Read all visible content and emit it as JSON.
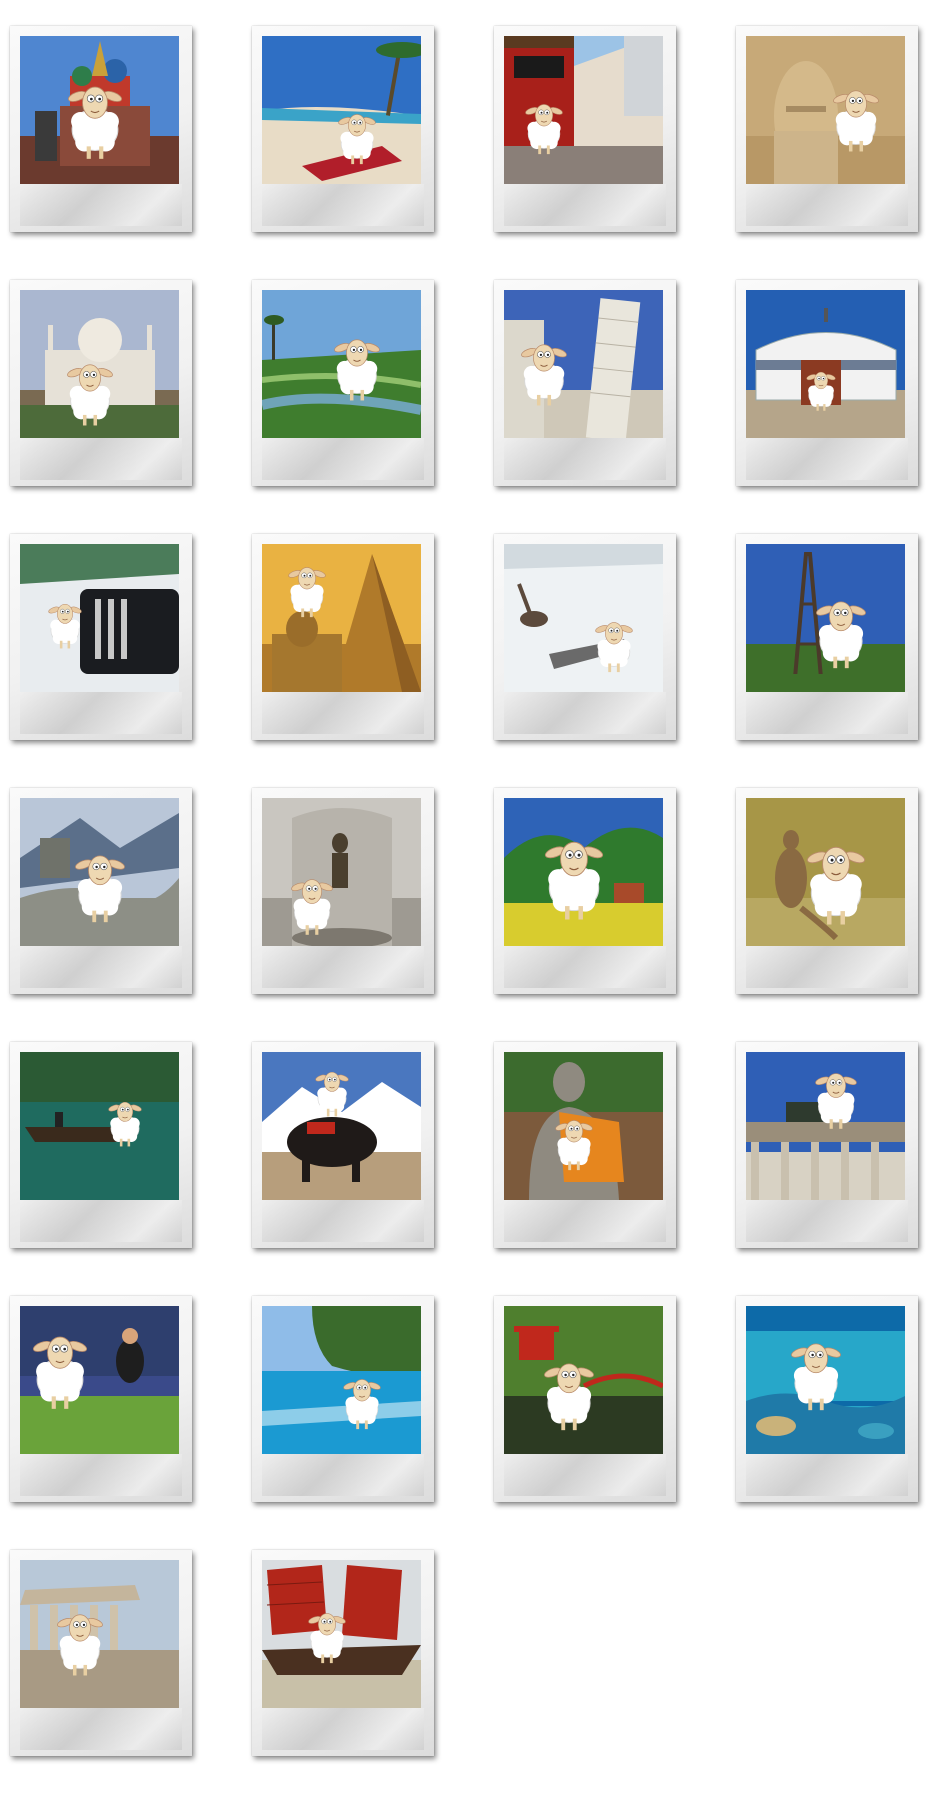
{
  "gallery": {
    "photos": [
      {
        "scene": "moscow-cathedral",
        "sky": "#4f86d0",
        "ground": "#6b3a2e",
        "accent": "#c0392b"
      },
      {
        "scene": "tropical-beach",
        "sky": "#2f6fc4",
        "ground": "#e8dcc6",
        "accent": "#b11e2a"
      },
      {
        "scene": "chinese-street",
        "sky": "#9cc3e6",
        "ground": "#8a7f78",
        "accent": "#a8201a"
      },
      {
        "scene": "stone-head-statue",
        "sky": "#c7a978",
        "ground": "#b89866",
        "accent": "#d4b98a"
      },
      {
        "scene": "taj-mahal",
        "sky": "#aab7d0",
        "ground": "#7a6a52",
        "accent": "#e6e1d7"
      },
      {
        "scene": "rice-terraces",
        "sky": "#6fa5d8",
        "ground": "#3f7d2e",
        "accent": "#8fbf6a"
      },
      {
        "scene": "leaning-tower-pisa",
        "sky": "#3d64b8",
        "ground": "#cfc8b8",
        "accent": "#e9e6dc"
      },
      {
        "scene": "yurt",
        "sky": "#245fb3",
        "ground": "#b5a58a",
        "accent": "#8b3a22"
      },
      {
        "scene": "limousine",
        "sky": "#e6ecef",
        "ground": "#1a1c20",
        "accent": "#2c7a3c"
      },
      {
        "scene": "sphinx-pyramid",
        "sky": "#e9b242",
        "ground": "#b07a2a",
        "accent": "#8e5e22"
      },
      {
        "scene": "reindeer-sled",
        "sky": "#c9d2d8",
        "ground": "#eef2f4",
        "accent": "#5c4a3c"
      },
      {
        "scene": "eiffel-tower",
        "sky": "#2f5fb6",
        "ground": "#3e6f2a",
        "accent": "#4b3a2a"
      },
      {
        "scene": "great-wall",
        "sky": "#b9c6d8",
        "ground": "#8d8f86",
        "accent": "#5b6f8a"
      },
      {
        "scene": "manneken-pis",
        "sky": "#c9c6c0",
        "ground": "#9e9a92",
        "accent": "#4a3f2e"
      },
      {
        "scene": "alpine-meadow",
        "sky": "#2e63b7",
        "ground": "#d8cc2e",
        "accent": "#2f7a2d"
      },
      {
        "scene": "kangaroo-outback",
        "sky": "#a79647",
        "ground": "#b8a862",
        "accent": "#8a6a42"
      },
      {
        "scene": "ha-long-boat",
        "sky": "#2b5a34",
        "ground": "#1f6b5f",
        "accent": "#3a2a1c"
      },
      {
        "scene": "yak-mountains",
        "sky": "#4a77bf",
        "ground": "#b79e7c",
        "accent": "#1f1a18"
      },
      {
        "scene": "buddha-statue",
        "sky": "#3c6b2e",
        "ground": "#7c5a3c",
        "accent": "#e6861e"
      },
      {
        "scene": "brandenburg-gate",
        "sky": "#2f5fb6",
        "ground": "#d8d2c4",
        "accent": "#9a8e7a"
      },
      {
        "scene": "rugby-match",
        "sky": "#2e3f6e",
        "ground": "#6aa33a",
        "accent": "#1e1e1e"
      },
      {
        "scene": "turquoise-lagoon",
        "sky": "#8fbce8",
        "ground": "#1b9ad2",
        "accent": "#3a6b2c"
      },
      {
        "scene": "japanese-garden",
        "sky": "#4f7f2e",
        "ground": "#2c3a22",
        "accent": "#c0281c"
      },
      {
        "scene": "coral-reef",
        "sky": "#0d6aa8",
        "ground": "#27a7c9",
        "accent": "#c9b27a"
      },
      {
        "scene": "parthenon",
        "sky": "#b8c8d8",
        "ground": "#a89a84",
        "accent": "#c4b59c"
      },
      {
        "scene": "chinese-junk",
        "sky": "#d9dde0",
        "ground": "#c8c0a8",
        "accent": "#b2261a"
      }
    ]
  }
}
